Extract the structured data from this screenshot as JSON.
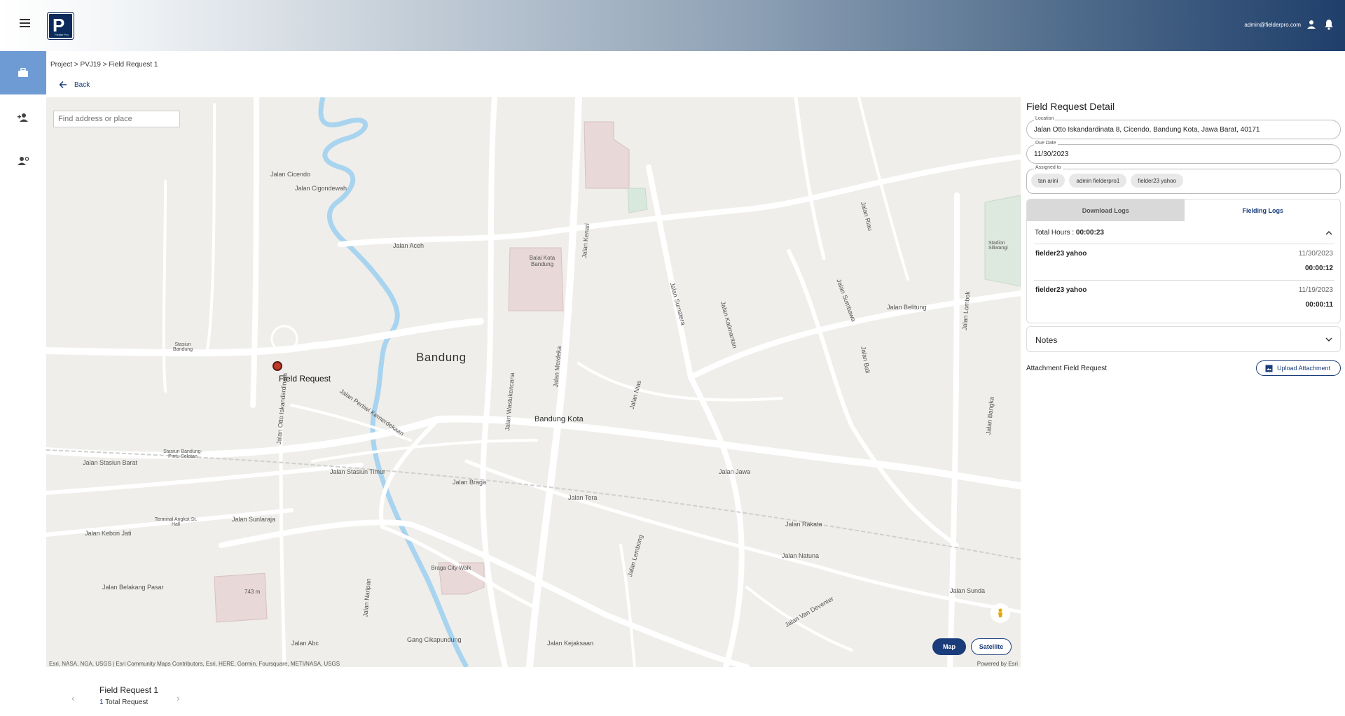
{
  "header": {
    "logo_text": "Fielder Pro",
    "user_email": "admin@fielderpro.com"
  },
  "sidebar": {
    "items": [
      {
        "icon": "briefcase-icon",
        "active": true
      },
      {
        "icon": "person-add-icon",
        "active": false
      },
      {
        "icon": "person-settings-icon",
        "active": false
      }
    ]
  },
  "breadcrumb": "Project > PVJ19 > Field Request 1",
  "back_label": "Back",
  "map": {
    "search_placeholder": "Find address or place",
    "city": "Bandung",
    "district": "Bandung Kota",
    "pin_label": "Field Request",
    "labels": [
      "Jalan Cicendo",
      "Jalan Cigondewah",
      "Jalan Aceh",
      "Jalan Wastukencana",
      "Jalan Merdeka",
      "Jalan Sumatera",
      "Jalan Kalimantan",
      "Jalan Sumbawa",
      "Jalan Belitung",
      "Jalan Lombok",
      "Jalan Riau",
      "Jalan Stasiun Barat",
      "Jalan Stasiun Timur",
      "Jalan Braga",
      "Jalan Tera",
      "Jalan Jawa",
      "Jalan Sunlaraja",
      "Jalan Kebon Jati",
      "Jalan Belakang Pasar",
      "Jalan Naripan",
      "Jalan Rakata",
      "Jalan Natuna",
      "Jalan Sunda",
      "Jalan Abc",
      "Gang Cikapundung",
      "Jalan Kejaksaan",
      "Jalan Van Deventer",
      "Jalan Bali",
      "Jalan Bangka",
      "Jalan Lembong",
      "Jalan Pertiwi Kemerdekaan",
      "Jalan Otto Iskandardinata",
      "Jalan Kenari",
      "Jalan Nias"
    ],
    "places": [
      "Balai Kota Bandung",
      "Stasiun Bandung",
      "Stasiun Bandung-Pintu Selatan",
      "Terminal Angkot St. Hall",
      "Braga City Walk",
      "Stadion Siliwangi",
      "743 m"
    ],
    "attribution": "Esri, NASA, NGA, USGS | Esri Community Maps Contributors, Esri, HERE, Garmin, Foursquare, METI/NASA, USGS",
    "powered": "Powered by Esri",
    "btn_map": "Map",
    "btn_satellite": "Satellite"
  },
  "carousel": {
    "title": "Field Request 1",
    "count": "1",
    "count_label": "Total Request"
  },
  "panel": {
    "title": "Field Request Detail",
    "location_label": "Location",
    "location_value": "Jalan Otto Iskandardinata 8, Cicendo, Bandung Kota, Jawa Barat, 40171",
    "due_label": "Due Date",
    "due_value": "11/30/2023",
    "assigned_label": "Assigned to",
    "assignees": [
      "tan arini",
      "admin fielderpro1",
      "fielder23 yahoo"
    ],
    "tab_download": "Download Logs",
    "tab_fielding": "Fielding Logs",
    "total_label": "Total Hours : ",
    "total_value": "00:00:23",
    "logs": [
      {
        "name": "fielder23 yahoo",
        "date": "11/30/2023",
        "time": "00:00:12"
      },
      {
        "name": "fielder23 yahoo",
        "date": "11/19/2023",
        "time": "00:00:11"
      }
    ],
    "notes_label": "Notes",
    "attachment_label": "Attachment Field Request",
    "upload_label": "Upload Attachment"
  },
  "colors": {
    "brand": "#1a3c7a",
    "sidebar_active": "#6e9bd3",
    "pin": "#c0392b",
    "map_bg": "#efeeea"
  }
}
